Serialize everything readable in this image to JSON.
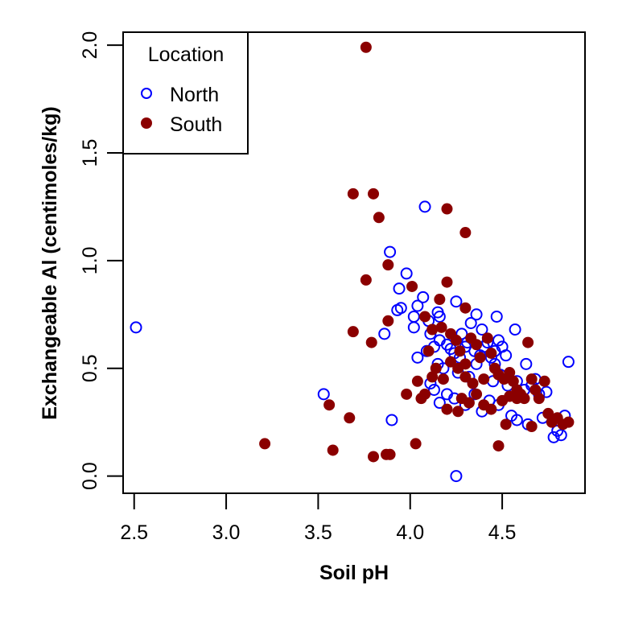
{
  "chart_data": {
    "type": "scatter",
    "title": "",
    "xlabel": "Soil pH",
    "ylabel": "Exchangeable Al (centimoles/kg)",
    "xlim": [
      2.44,
      4.95
    ],
    "ylim": [
      -0.08,
      2.06
    ],
    "xticks": [
      2.5,
      3.0,
      3.5,
      4.0,
      4.5
    ],
    "xtick_labels": [
      "2.5",
      "3.0",
      "3.5",
      "4.0",
      "4.5"
    ],
    "yticks": [
      0.0,
      0.5,
      1.0,
      1.5,
      2.0
    ],
    "ytick_labels": [
      "0.0",
      "0.5",
      "1.0",
      "1.5",
      "2.0"
    ],
    "grid": false,
    "legend": {
      "title": "Location",
      "placement": "top-left",
      "entries": [
        "North",
        "South"
      ]
    },
    "series": [
      {
        "name": "North",
        "marker": "open-circle",
        "color": "#0000ff",
        "points": [
          [
            2.51,
            0.69
          ],
          [
            3.53,
            0.38
          ],
          [
            3.9,
            0.26
          ],
          [
            4.25,
            0.0
          ],
          [
            3.89,
            1.04
          ],
          [
            3.98,
            0.94
          ],
          [
            4.08,
            1.25
          ],
          [
            3.94,
            0.87
          ],
          [
            3.86,
            0.66
          ],
          [
            3.93,
            0.77
          ],
          [
            3.95,
            0.78
          ],
          [
            4.04,
            0.79
          ],
          [
            4.02,
            0.74
          ],
          [
            4.07,
            0.83
          ],
          [
            4.02,
            0.69
          ],
          [
            4.1,
            0.72
          ],
          [
            4.15,
            0.76
          ],
          [
            4.16,
            0.74
          ],
          [
            4.25,
            0.81
          ],
          [
            4.33,
            0.71
          ],
          [
            4.36,
            0.75
          ],
          [
            4.47,
            0.74
          ],
          [
            4.57,
            0.68
          ],
          [
            4.86,
            0.53
          ],
          [
            4.09,
            0.58
          ],
          [
            4.13,
            0.6
          ],
          [
            4.16,
            0.63
          ],
          [
            4.2,
            0.61
          ],
          [
            4.22,
            0.59
          ],
          [
            4.24,
            0.57
          ],
          [
            4.27,
            0.55
          ],
          [
            4.3,
            0.6
          ],
          [
            4.31,
            0.62
          ],
          [
            4.35,
            0.58
          ],
          [
            4.38,
            0.56
          ],
          [
            4.4,
            0.6
          ],
          [
            4.42,
            0.62
          ],
          [
            4.44,
            0.55
          ],
          [
            4.46,
            0.58
          ],
          [
            4.48,
            0.63
          ],
          [
            4.5,
            0.6
          ],
          [
            4.52,
            0.56
          ],
          [
            4.15,
            0.52
          ],
          [
            4.18,
            0.5
          ],
          [
            4.26,
            0.48
          ],
          [
            4.32,
            0.46
          ],
          [
            4.36,
            0.52
          ],
          [
            4.45,
            0.44
          ],
          [
            4.49,
            0.47
          ],
          [
            4.53,
            0.42
          ],
          [
            4.58,
            0.44
          ],
          [
            4.62,
            0.4
          ],
          [
            4.66,
            0.42
          ],
          [
            4.68,
            0.45
          ],
          [
            4.63,
            0.52
          ],
          [
            4.11,
            0.43
          ],
          [
            4.13,
            0.4
          ],
          [
            4.16,
            0.34
          ],
          [
            4.2,
            0.38
          ],
          [
            4.24,
            0.36
          ],
          [
            4.3,
            0.33
          ],
          [
            4.35,
            0.38
          ],
          [
            4.39,
            0.3
          ],
          [
            4.43,
            0.35
          ],
          [
            4.48,
            0.33
          ],
          [
            4.55,
            0.28
          ],
          [
            4.58,
            0.26
          ],
          [
            4.64,
            0.24
          ],
          [
            4.7,
            0.38
          ],
          [
            4.74,
            0.39
          ],
          [
            4.72,
            0.27
          ],
          [
            4.78,
            0.18
          ],
          [
            4.8,
            0.21
          ],
          [
            4.82,
            0.19
          ],
          [
            4.84,
            0.28
          ],
          [
            4.04,
            0.55
          ],
          [
            4.11,
            0.66
          ],
          [
            4.28,
            0.66
          ],
          [
            4.39,
            0.68
          ],
          [
            4.46,
            0.52
          ]
        ]
      },
      {
        "name": "South",
        "marker": "filled-circle",
        "color": "#8b0000",
        "points": [
          [
            3.76,
            1.99
          ],
          [
            3.69,
            1.31
          ],
          [
            3.8,
            1.31
          ],
          [
            3.83,
            1.2
          ],
          [
            4.2,
            1.24
          ],
          [
            4.3,
            1.13
          ],
          [
            3.88,
            0.98
          ],
          [
            3.76,
            0.91
          ],
          [
            4.01,
            0.88
          ],
          [
            4.2,
            0.9
          ],
          [
            3.88,
            0.72
          ],
          [
            3.69,
            0.67
          ],
          [
            3.79,
            0.62
          ],
          [
            3.21,
            0.15
          ],
          [
            3.56,
            0.33
          ],
          [
            3.58,
            0.12
          ],
          [
            3.67,
            0.27
          ],
          [
            3.8,
            0.09
          ],
          [
            3.87,
            0.1
          ],
          [
            3.89,
            0.1
          ],
          [
            4.03,
            0.15
          ],
          [
            4.48,
            0.14
          ],
          [
            3.98,
            0.38
          ],
          [
            4.06,
            0.36
          ],
          [
            4.08,
            0.38
          ],
          [
            4.12,
            0.46
          ],
          [
            4.14,
            0.5
          ],
          [
            4.16,
            0.82
          ],
          [
            4.17,
            0.69
          ],
          [
            4.08,
            0.74
          ],
          [
            4.12,
            0.68
          ],
          [
            4.22,
            0.66
          ],
          [
            4.25,
            0.63
          ],
          [
            4.27,
            0.58
          ],
          [
            4.3,
            0.78
          ],
          [
            4.33,
            0.64
          ],
          [
            4.36,
            0.61
          ],
          [
            4.38,
            0.55
          ],
          [
            4.42,
            0.64
          ],
          [
            4.44,
            0.57
          ],
          [
            4.46,
            0.5
          ],
          [
            4.48,
            0.47
          ],
          [
            4.51,
            0.45
          ],
          [
            4.54,
            0.48
          ],
          [
            4.56,
            0.44
          ],
          [
            4.58,
            0.4
          ],
          [
            4.6,
            0.38
          ],
          [
            4.62,
            0.36
          ],
          [
            4.64,
            0.62
          ],
          [
            4.66,
            0.45
          ],
          [
            4.68,
            0.4
          ],
          [
            4.7,
            0.36
          ],
          [
            4.73,
            0.44
          ],
          [
            4.75,
            0.29
          ],
          [
            4.77,
            0.25
          ],
          [
            4.8,
            0.27
          ],
          [
            4.83,
            0.24
          ],
          [
            4.86,
            0.25
          ],
          [
            4.66,
            0.23
          ],
          [
            4.52,
            0.24
          ],
          [
            4.2,
            0.31
          ],
          [
            4.26,
            0.3
          ],
          [
            4.28,
            0.36
          ],
          [
            4.32,
            0.34
          ],
          [
            4.36,
            0.38
          ],
          [
            4.4,
            0.33
          ],
          [
            4.44,
            0.31
          ],
          [
            4.5,
            0.35
          ],
          [
            4.54,
            0.37
          ],
          [
            4.58,
            0.36
          ],
          [
            4.22,
            0.53
          ],
          [
            4.26,
            0.5
          ],
          [
            4.3,
            0.46
          ],
          [
            4.34,
            0.43
          ],
          [
            4.4,
            0.45
          ],
          [
            4.04,
            0.44
          ],
          [
            4.18,
            0.45
          ],
          [
            4.1,
            0.58
          ],
          [
            4.3,
            0.52
          ]
        ]
      }
    ]
  }
}
